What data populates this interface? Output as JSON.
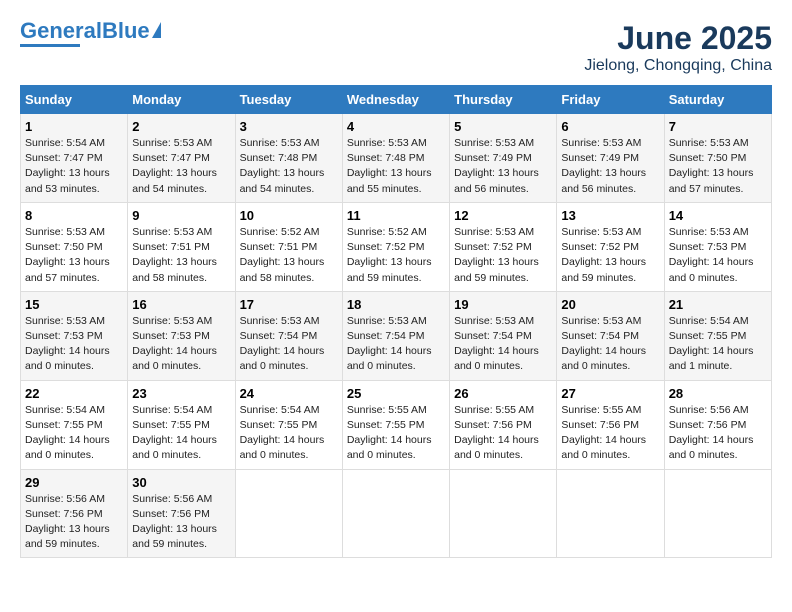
{
  "header": {
    "logo_line1": "General",
    "logo_line2": "Blue",
    "main_title": "June 2025",
    "subtitle": "Jielong, Chongqing, China"
  },
  "calendar": {
    "days_of_week": [
      "Sunday",
      "Monday",
      "Tuesday",
      "Wednesday",
      "Thursday",
      "Friday",
      "Saturday"
    ],
    "weeks": [
      [
        {
          "day": "",
          "info": ""
        },
        {
          "day": "2",
          "info": "Sunrise: 5:53 AM\nSunset: 7:47 PM\nDaylight: 13 hours\nand 54 minutes."
        },
        {
          "day": "3",
          "info": "Sunrise: 5:53 AM\nSunset: 7:48 PM\nDaylight: 13 hours\nand 54 minutes."
        },
        {
          "day": "4",
          "info": "Sunrise: 5:53 AM\nSunset: 7:48 PM\nDaylight: 13 hours\nand 55 minutes."
        },
        {
          "day": "5",
          "info": "Sunrise: 5:53 AM\nSunset: 7:49 PM\nDaylight: 13 hours\nand 56 minutes."
        },
        {
          "day": "6",
          "info": "Sunrise: 5:53 AM\nSunset: 7:49 PM\nDaylight: 13 hours\nand 56 minutes."
        },
        {
          "day": "7",
          "info": "Sunrise: 5:53 AM\nSunset: 7:50 PM\nDaylight: 13 hours\nand 57 minutes."
        }
      ],
      [
        {
          "day": "1",
          "info": "Sunrise: 5:54 AM\nSunset: 7:47 PM\nDaylight: 13 hours\nand 53 minutes."
        },
        {
          "day": "9",
          "info": "Sunrise: 5:53 AM\nSunset: 7:51 PM\nDaylight: 13 hours\nand 58 minutes."
        },
        {
          "day": "10",
          "info": "Sunrise: 5:52 AM\nSunset: 7:51 PM\nDaylight: 13 hours\nand 58 minutes."
        },
        {
          "day": "11",
          "info": "Sunrise: 5:52 AM\nSunset: 7:52 PM\nDaylight: 13 hours\nand 59 minutes."
        },
        {
          "day": "12",
          "info": "Sunrise: 5:53 AM\nSunset: 7:52 PM\nDaylight: 13 hours\nand 59 minutes."
        },
        {
          "day": "13",
          "info": "Sunrise: 5:53 AM\nSunset: 7:52 PM\nDaylight: 13 hours\nand 59 minutes."
        },
        {
          "day": "14",
          "info": "Sunrise: 5:53 AM\nSunset: 7:53 PM\nDaylight: 14 hours\nand 0 minutes."
        }
      ],
      [
        {
          "day": "8",
          "info": "Sunrise: 5:53 AM\nSunset: 7:50 PM\nDaylight: 13 hours\nand 57 minutes."
        },
        {
          "day": "16",
          "info": "Sunrise: 5:53 AM\nSunset: 7:53 PM\nDaylight: 14 hours\nand 0 minutes."
        },
        {
          "day": "17",
          "info": "Sunrise: 5:53 AM\nSunset: 7:54 PM\nDaylight: 14 hours\nand 0 minutes."
        },
        {
          "day": "18",
          "info": "Sunrise: 5:53 AM\nSunset: 7:54 PM\nDaylight: 14 hours\nand 0 minutes."
        },
        {
          "day": "19",
          "info": "Sunrise: 5:53 AM\nSunset: 7:54 PM\nDaylight: 14 hours\nand 0 minutes."
        },
        {
          "day": "20",
          "info": "Sunrise: 5:53 AM\nSunset: 7:54 PM\nDaylight: 14 hours\nand 0 minutes."
        },
        {
          "day": "21",
          "info": "Sunrise: 5:54 AM\nSunset: 7:55 PM\nDaylight: 14 hours\nand 1 minute."
        }
      ],
      [
        {
          "day": "15",
          "info": "Sunrise: 5:53 AM\nSunset: 7:53 PM\nDaylight: 14 hours\nand 0 minutes."
        },
        {
          "day": "23",
          "info": "Sunrise: 5:54 AM\nSunset: 7:55 PM\nDaylight: 14 hours\nand 0 minutes."
        },
        {
          "day": "24",
          "info": "Sunrise: 5:54 AM\nSunset: 7:55 PM\nDaylight: 14 hours\nand 0 minutes."
        },
        {
          "day": "25",
          "info": "Sunrise: 5:55 AM\nSunset: 7:55 PM\nDaylight: 14 hours\nand 0 minutes."
        },
        {
          "day": "26",
          "info": "Sunrise: 5:55 AM\nSunset: 7:56 PM\nDaylight: 14 hours\nand 0 minutes."
        },
        {
          "day": "27",
          "info": "Sunrise: 5:55 AM\nSunset: 7:56 PM\nDaylight: 14 hours\nand 0 minutes."
        },
        {
          "day": "28",
          "info": "Sunrise: 5:56 AM\nSunset: 7:56 PM\nDaylight: 14 hours\nand 0 minutes."
        }
      ],
      [
        {
          "day": "22",
          "info": "Sunrise: 5:54 AM\nSunset: 7:55 PM\nDaylight: 14 hours\nand 0 minutes."
        },
        {
          "day": "30",
          "info": "Sunrise: 5:56 AM\nSunset: 7:56 PM\nDaylight: 13 hours\nand 59 minutes."
        },
        {
          "day": "",
          "info": ""
        },
        {
          "day": "",
          "info": ""
        },
        {
          "day": "",
          "info": ""
        },
        {
          "day": "",
          "info": ""
        },
        {
          "day": "",
          "info": ""
        }
      ],
      [
        {
          "day": "29",
          "info": "Sunrise: 5:56 AM\nSunset: 7:56 PM\nDaylight: 13 hours\nand 59 minutes."
        },
        {
          "day": "",
          "info": ""
        },
        {
          "day": "",
          "info": ""
        },
        {
          "day": "",
          "info": ""
        },
        {
          "day": "",
          "info": ""
        },
        {
          "day": "",
          "info": ""
        },
        {
          "day": "",
          "info": ""
        }
      ]
    ]
  }
}
